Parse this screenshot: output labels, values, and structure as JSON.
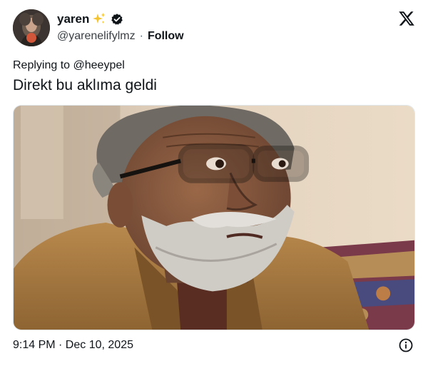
{
  "author": {
    "display_name": "yaren",
    "name_emoji": "sparkles",
    "verified": true,
    "handle": "@yarenelifylmz",
    "separator": "·",
    "follow_label": "Follow"
  },
  "tweet": {
    "reply_prefix": "Replying to",
    "reply_to": "@heeypel",
    "text": "Direkt bu aklıma geldi",
    "timestamp": "9:14 PM · Dec 10, 2025"
  },
  "icons": {
    "platform_logo": "x-logo-icon",
    "info": "info-icon",
    "verified": "verified-badge-icon",
    "sparkles": "sparkles-icon"
  },
  "colors": {
    "text": "#0f1419",
    "secondary": "#536471",
    "sparkle": "#f4c430"
  }
}
